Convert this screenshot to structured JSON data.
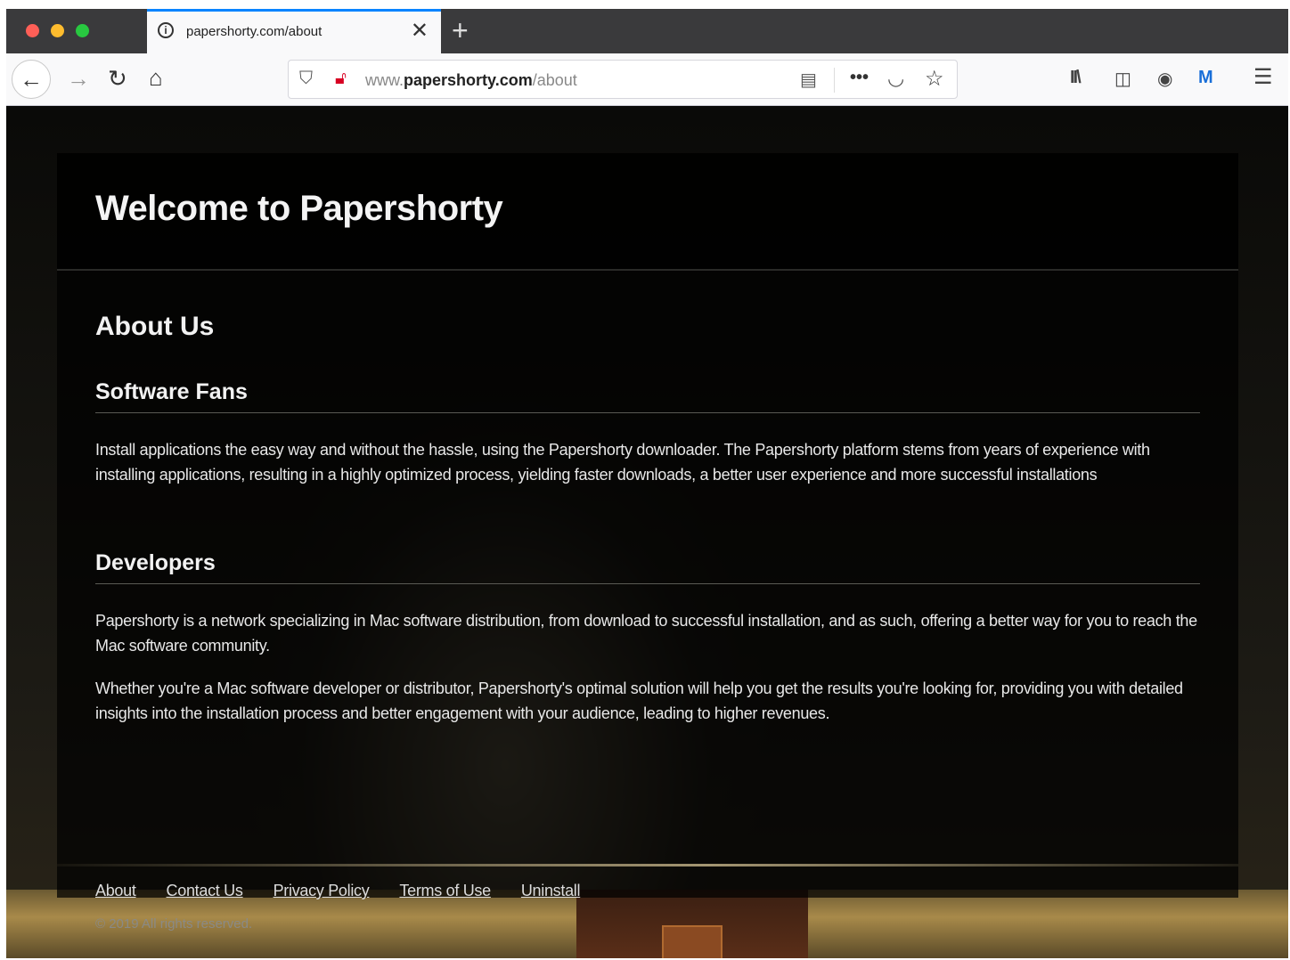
{
  "browser": {
    "tab_title": "papershorty.com/about",
    "tab_close": "✕",
    "new_tab": "+",
    "nav": {
      "back": "←",
      "forward": "→",
      "reload": "↻",
      "home": "⌂"
    },
    "url_prefix": "www.",
    "url_domain": "papershorty.com",
    "url_path": "/about",
    "icons": [
      "info-icon",
      "shield-icon",
      "insecure-lock-icon",
      "reader-view-icon",
      "more-icon",
      "pocket-icon",
      "bookmark-star-icon",
      "library-icon",
      "sidebar-icon",
      "account-icon",
      "extension-icon",
      "menu-icon"
    ],
    "url_more": "•••",
    "menu": "☰"
  },
  "page": {
    "site_title": "Welcome to Papershorty",
    "about_title": "About Us",
    "sections": [
      {
        "title": "Software Fans",
        "paragraphs": [
          "Install applications the easy way and without the hassle, using the Papershorty downloader. The Papershorty platform stems from years of experience with installing applications, resulting in a highly optimized process, yielding faster downloads, a better user experience and more successful installations"
        ]
      },
      {
        "title": "Developers",
        "paragraphs": [
          "Papershorty is a network specializing in Mac software distribution, from download to successful installation, and as such, offering a better way for you to reach the Mac software community.",
          "Whether you're a Mac software developer or distributor, Papershorty's optimal solution will help you get the results you're looking for, providing you with detailed insights into the installation process and better engagement with your audience, leading to higher revenues."
        ]
      }
    ],
    "footer": {
      "links": [
        "About",
        "Contact Us",
        "Privacy Policy",
        "Terms of Use",
        "Uninstall"
      ],
      "copyright": "© 2019 All rights reserved."
    }
  },
  "colors": {
    "tab_accent": "#0a84ff",
    "traffic_red": "#fe5f57",
    "traffic_yellow": "#febc2e",
    "traffic_green": "#28c840"
  }
}
